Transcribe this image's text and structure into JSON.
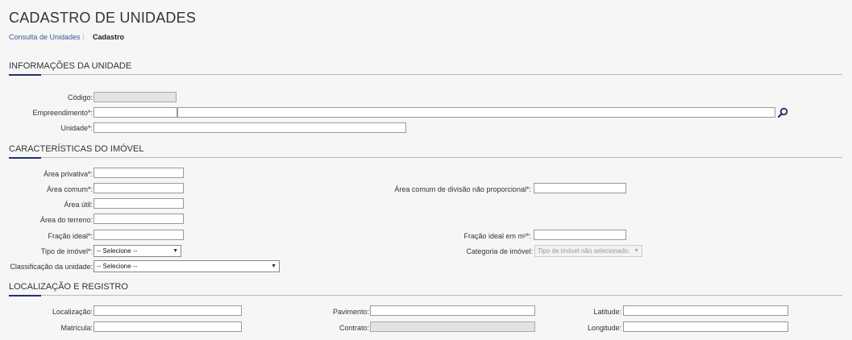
{
  "page": {
    "title": "CADASTRO DE UNIDADES"
  },
  "breadcrumb": {
    "link": "Consulta de Unidades",
    "separator": "|",
    "current": "Cadastro"
  },
  "sections": {
    "info": "INFORMAÇÕES DA UNIDADE",
    "caracteristicas": "CARACTERÍSTICAS DO IMÓVEL",
    "localizacao": "LOCALIZAÇÃO E REGISTRO"
  },
  "info": {
    "codigo_label": "Código:",
    "empreendimento_label": "Empreendimento*:",
    "unidade_label": "Unidade*:",
    "search_icon": "search-icon"
  },
  "caracteristicas": {
    "area_privativa_label": "Área privativa*:",
    "area_comum_label": "Área comum*:",
    "area_util_label": "Área útil:",
    "area_terreno_label": "Área do terreno:",
    "fracao_ideal_label": "Fração ideal*:",
    "tipo_imovel_label": "Tipo de imóvel*:",
    "tipo_imovel_value": "-- Selecione --",
    "classificacao_label": "Classificação da unidade:",
    "classificacao_value": "-- Selecione --",
    "area_comum_np_label": "Área comum de divisão não proporcional*:",
    "fracao_m2_label": "Fração ideal em m²*:",
    "categoria_label": "Categoria de imóvel:",
    "categoria_value": "Tipo de imóvel não selecionado."
  },
  "localizacao": {
    "localizacao_label": "Localização:",
    "matricula_label": "Matrícula:",
    "pavimento_label": "Pavimento:",
    "contrato_label": "Contrato:",
    "latitude_label": "Latitude:",
    "longitude_label": "Longitude:"
  },
  "colors": {
    "accent": "#25306b",
    "link": "#3b5b8c"
  }
}
